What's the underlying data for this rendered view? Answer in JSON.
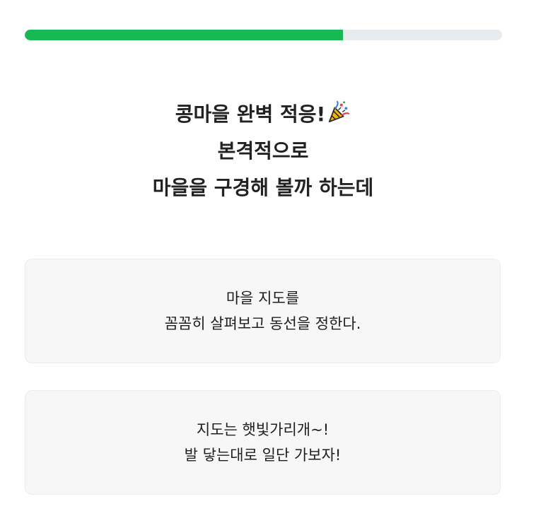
{
  "progress": {
    "fraction": 0.667
  },
  "question": {
    "line1": "콩마을 완벽 적응!",
    "line2": "본격적으로",
    "line3": "마을을 구경해 볼까 하는데",
    "icon": "party-popper-icon"
  },
  "options": [
    {
      "line1": "마을 지도를",
      "line2": "꼼꼼히 살펴보고 동선을 정한다."
    },
    {
      "line1": "지도는 햇빛가리개~!",
      "line2": "발 닿는대로 일단 가보자!"
    }
  ],
  "colors": {
    "progress_fill": "#17b955",
    "progress_track": "#e8ebee",
    "option_background": "#f7f7f7"
  }
}
